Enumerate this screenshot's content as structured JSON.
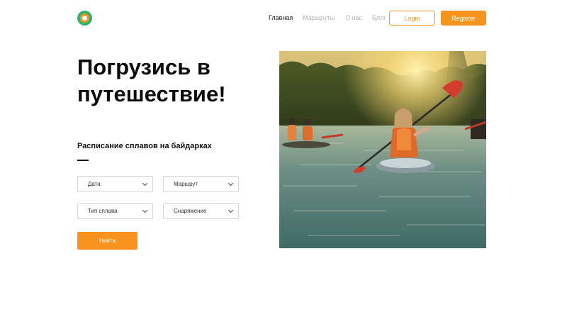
{
  "header": {
    "nav": [
      {
        "label": "Главная",
        "active": true
      },
      {
        "label": "Маршруты",
        "active": false
      },
      {
        "label": "О нас",
        "active": false
      },
      {
        "label": "Блог",
        "active": false
      }
    ],
    "login_label": "Login",
    "register_label": "Register"
  },
  "hero": {
    "title_line1": "Погрузись в",
    "title_line2": "путешествие!",
    "subtitle": "Расписание сплавов на байдарках"
  },
  "filters": {
    "date": "Дата",
    "route": "Маршрут",
    "type": "Тип сплава",
    "equipment": "Снаряжение"
  },
  "search_label": "Найти",
  "colors": {
    "accent": "#f7941d",
    "logo_green": "#2fb36a",
    "nav_inactive": "#b4b4b4"
  }
}
